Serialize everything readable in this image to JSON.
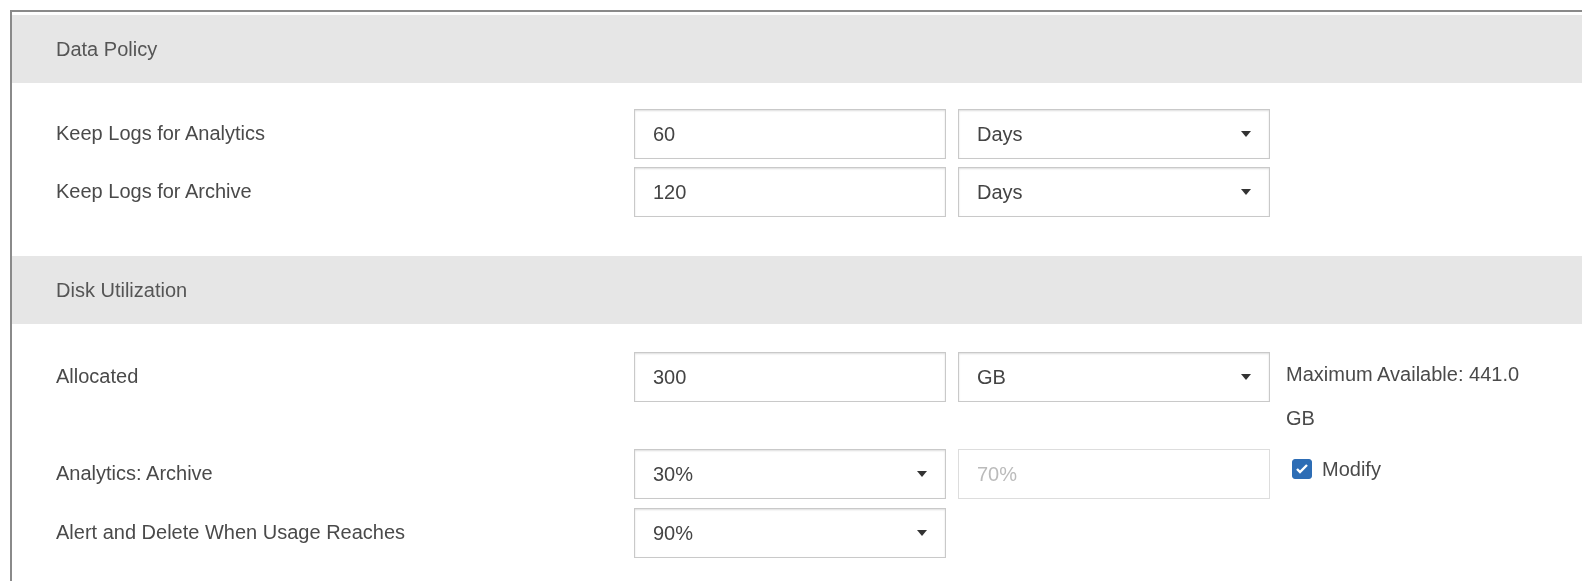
{
  "sections": [
    {
      "title": "Data Policy",
      "rows": [
        {
          "label": "Keep Logs for Analytics",
          "fields": [
            {
              "kind": "input",
              "value": "60",
              "disabled": false
            },
            {
              "kind": "select",
              "value": "Days"
            }
          ]
        },
        {
          "label": "Keep Logs for Archive",
          "fields": [
            {
              "kind": "input",
              "value": "120",
              "disabled": false
            },
            {
              "kind": "select",
              "value": "Days"
            }
          ]
        }
      ]
    },
    {
      "title": "Disk Utilization",
      "rows": [
        {
          "label": "Allocated",
          "fields": [
            {
              "kind": "input",
              "value": "300",
              "disabled": false
            },
            {
              "kind": "select",
              "value": "GB"
            },
            {
              "kind": "note",
              "value": "Maximum Available: 441.0 GB"
            }
          ]
        },
        {
          "label": "Analytics: Archive",
          "fields": [
            {
              "kind": "select",
              "value": "30%"
            },
            {
              "kind": "input",
              "value": "70%",
              "disabled": true
            },
            {
              "kind": "checkbox",
              "value": "Modify",
              "checked": true
            }
          ]
        },
        {
          "label": "Alert and Delete When Usage Reaches",
          "fields": [
            {
              "kind": "select",
              "value": "90%"
            }
          ]
        }
      ]
    }
  ]
}
